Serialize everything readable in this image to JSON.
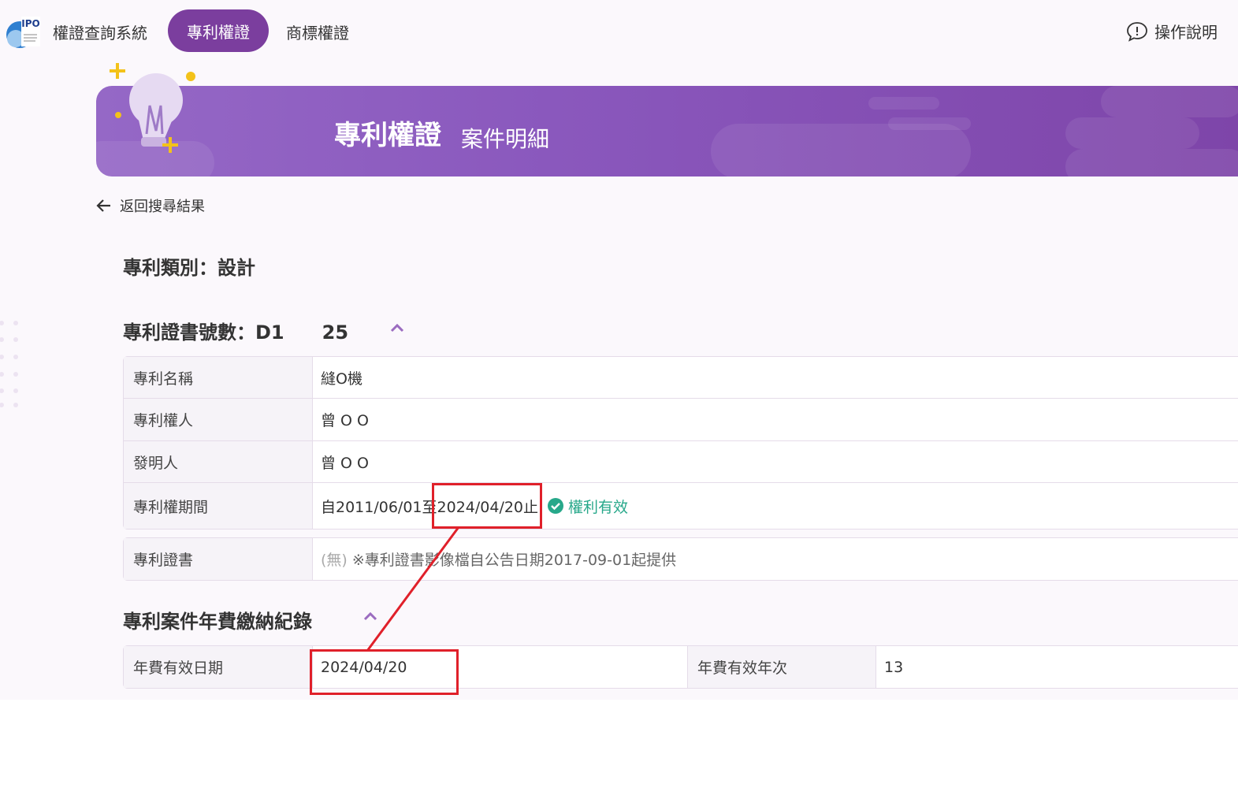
{
  "nav": {
    "brand": "權證查詢系統",
    "active_tab": "專利權證",
    "tab2": "商標權證",
    "help": "操作說明"
  },
  "banner": {
    "title": "專利權證",
    "subtitle": "案件明細"
  },
  "back_link": "返回搜尋結果",
  "patent_type": "專利類別：設計",
  "certificate": {
    "heading_prefix": "專利證書號數：D1",
    "heading_suffix": "25"
  },
  "details": [
    {
      "label": "專利名稱",
      "value": "縫O機"
    },
    {
      "label": "專利權人",
      "value": "曾 O O"
    },
    {
      "label": "發明人",
      "value": "曾 O O"
    }
  ],
  "period": {
    "label": "專利權期間",
    "prefix": "自2011/06/01至",
    "end": "2024/04/20止",
    "status": "權利有效"
  },
  "cert_image": {
    "label": "專利證書",
    "none": "(無)",
    "note": "※專利證書影像檔自公告日期2017-09-01起提供"
  },
  "annual_fee": {
    "heading": "專利案件年費繳納紀錄",
    "valid_date_label": "年費有效日期",
    "valid_date": "2024/04/20",
    "valid_year_label": "年費有效年次",
    "valid_year": "13"
  },
  "colors": {
    "accent": "#7b3e9e",
    "valid": "#27a88a",
    "highlight": "#e0202a"
  }
}
